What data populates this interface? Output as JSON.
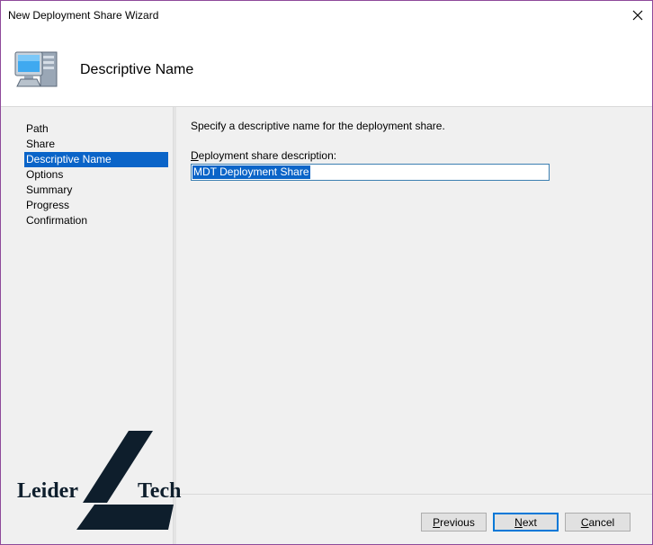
{
  "window": {
    "title": "New Deployment Share Wizard",
    "close_icon": "close-icon"
  },
  "header": {
    "icon": "computer-icon",
    "title": "Descriptive Name"
  },
  "nav": {
    "items": [
      {
        "label": "Path",
        "selected": false
      },
      {
        "label": "Share",
        "selected": false
      },
      {
        "label": "Descriptive Name",
        "selected": true
      },
      {
        "label": "Options",
        "selected": false
      },
      {
        "label": "Summary",
        "selected": false
      },
      {
        "label": "Progress",
        "selected": false
      },
      {
        "label": "Confirmation",
        "selected": false
      }
    ]
  },
  "content": {
    "instruction": "Specify a descriptive name for the deployment share.",
    "field_label_mnemonic": "D",
    "field_label_rest": "eployment share description:",
    "field_value": "MDT Deployment Share"
  },
  "buttons": {
    "previous_mnemonic": "P",
    "previous_rest": "revious",
    "next_mnemonic": "N",
    "next_rest": "ext",
    "cancel_mnemonic": "C",
    "cancel_rest": "ancel"
  },
  "watermark": {
    "left": "Leider",
    "right": "Tech"
  },
  "colors": {
    "selection": "#0a64c8",
    "window_border": "#8e4a9a",
    "logo": "#0e1e2c"
  }
}
